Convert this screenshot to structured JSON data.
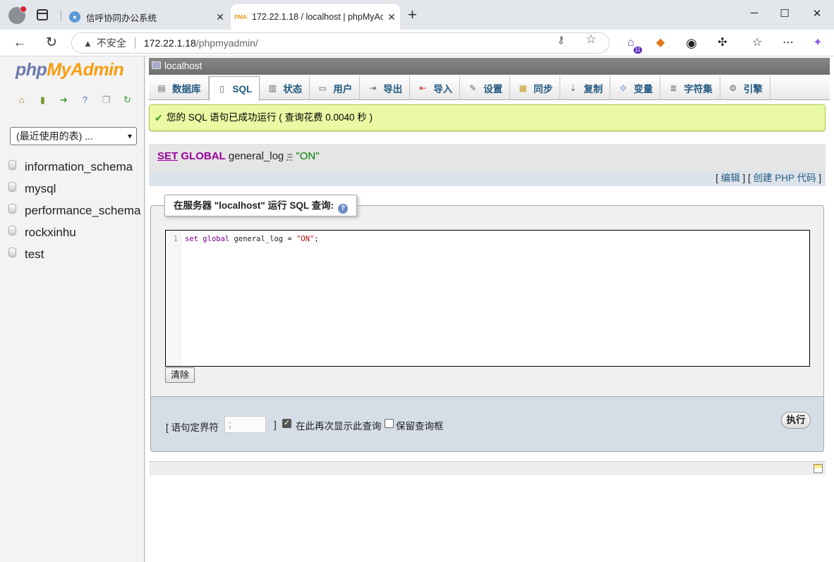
{
  "browser": {
    "tabs": [
      {
        "title": "信呼协同办公系统",
        "close": "✕"
      },
      {
        "title": "172.22.1.18 / localhost | phpMyAd",
        "favicon_text": "PMA",
        "close": "✕"
      }
    ],
    "new_tab": "+",
    "insecure_label": "不安全",
    "url_host": "172.22.1.18",
    "url_path": "/phpmyadmin/",
    "extension_badge": "11",
    "window_controls": [
      "─",
      "☐",
      "✕"
    ]
  },
  "sidebar": {
    "logo_php": "php",
    "logo_myadmin": "MyAdmin",
    "recent_select": "(最近使用的表) ...",
    "databases": [
      "information_schema",
      "mysql",
      "performance_schema",
      "rockxinhu",
      "test"
    ]
  },
  "main": {
    "server": "localhost",
    "tabs": [
      {
        "label": "数据库",
        "icon": "database-icon"
      },
      {
        "label": "SQL",
        "icon": "sql-icon"
      },
      {
        "label": "状态",
        "icon": "status-icon"
      },
      {
        "label": "用户",
        "icon": "users-icon"
      },
      {
        "label": "导出",
        "icon": "export-icon"
      },
      {
        "label": "导入",
        "icon": "import-icon"
      },
      {
        "label": "设置",
        "icon": "settings-icon"
      },
      {
        "label": "同步",
        "icon": "sync-icon"
      },
      {
        "label": "复制",
        "icon": "replication-icon"
      },
      {
        "label": "变量",
        "icon": "variables-icon"
      },
      {
        "label": "字符集",
        "icon": "charset-icon"
      },
      {
        "label": "引擎",
        "icon": "engines-icon"
      }
    ],
    "success_message": "您的 SQL 语句已成功运行 ( 查询花费 0.0040 秒 )",
    "executed_sql": {
      "kw1": "SET",
      "kw2": "GLOBAL",
      "ident": "general_log",
      "op": "=",
      "value": "\"ON\""
    },
    "links": {
      "edit": "编辑",
      "create_php": "创建 PHP 代码"
    },
    "query_legend": "在服务器 \"localhost\" 运行 SQL 查询:",
    "editor": {
      "line_no": "1",
      "kw_set": "set",
      "kw_global": "global",
      "rest": " general_log = ",
      "str": "\"ON\"",
      "end": ";"
    },
    "clear_button": "清除",
    "delimiter_label": "[ 语句定界符",
    "delimiter_value": ";",
    "delimiter_end": "]",
    "show_again_label": "在此再次显示此查询",
    "show_again_checked": true,
    "retain_box_label": "保留查询框",
    "retain_box_checked": false,
    "go_button": "执行"
  }
}
